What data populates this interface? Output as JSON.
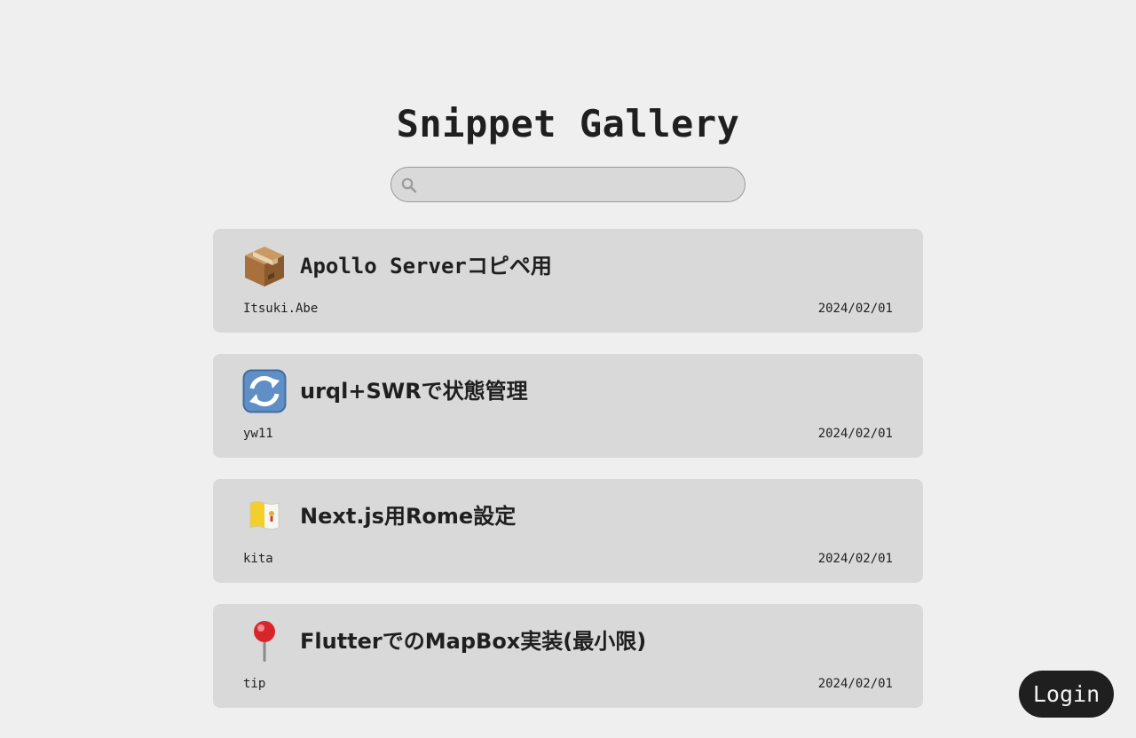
{
  "header": {
    "title": "Snippet Gallery"
  },
  "search": {
    "placeholder": "",
    "value": "",
    "icon": "search-icon"
  },
  "snippets": [
    {
      "emoji": "package-icon",
      "title": "Apollo Serverコピペ用",
      "author": "Itsuki.Abe",
      "date": "2024/02/01"
    },
    {
      "emoji": "refresh-arrows-icon",
      "title": "urql+SWRで状態管理",
      "author": "yw11",
      "date": "2024/02/01"
    },
    {
      "emoji": "vatican-flag-icon",
      "title": "Next.js用Rome設定",
      "author": "kita",
      "date": "2024/02/01"
    },
    {
      "emoji": "round-pushpin-icon",
      "title": "FlutterでのMapBox実装(最小限)",
      "author": "tip",
      "date": "2024/02/01"
    }
  ],
  "login": {
    "label": "Login"
  },
  "colors": {
    "background": "#efefef",
    "card": "#d9d9d9",
    "text": "#1f1f1f",
    "login_bg": "#1f1f1f"
  }
}
